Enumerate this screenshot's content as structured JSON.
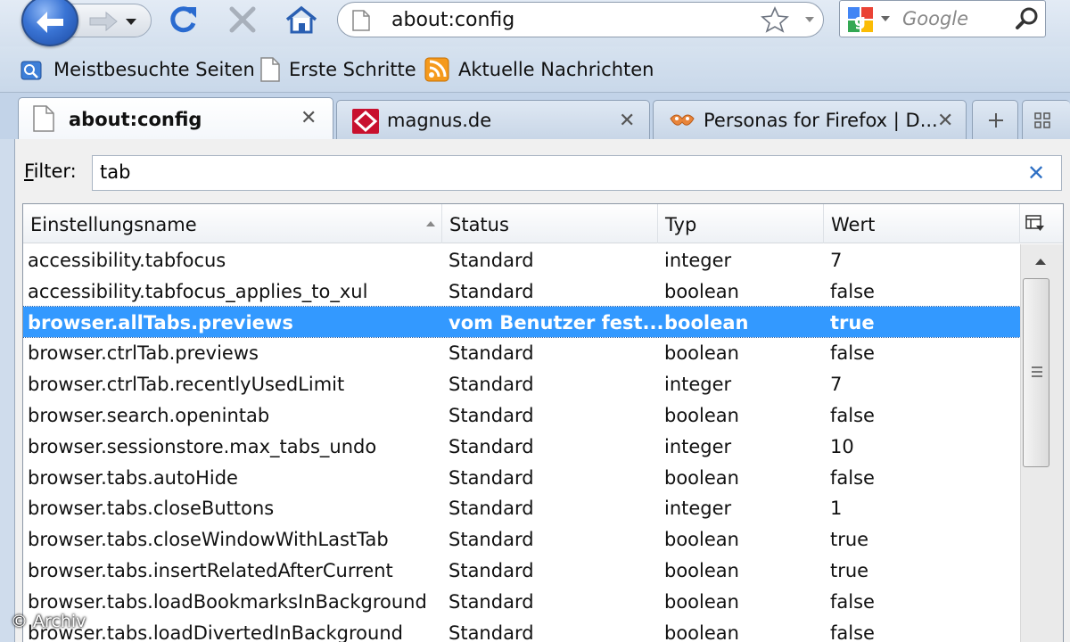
{
  "toolbar": {
    "url": "about:config",
    "search_placeholder": "Google"
  },
  "bookmarks": [
    {
      "label": "Meistbesuchte Seiten",
      "icon": "most-visited-icon"
    },
    {
      "label": "Erste Schritte",
      "icon": "page-icon"
    },
    {
      "label": "Aktuelle Nachrichten",
      "icon": "rss-feed-icon"
    }
  ],
  "tabs": [
    {
      "title": "about:config",
      "active": true
    },
    {
      "title": "magnus.de",
      "active": false
    },
    {
      "title": "Personas for Firefox | D...",
      "active": false
    }
  ],
  "filter": {
    "label_underlined": "F",
    "label_rest": "ilter:",
    "value": "tab"
  },
  "columns": {
    "name": "Einstellungsname",
    "status": "Status",
    "type": "Typ",
    "value": "Wert"
  },
  "rows": [
    {
      "name": "accessibility.tabfocus",
      "status": "Standard",
      "type": "integer",
      "value": "7"
    },
    {
      "name": "accessibility.tabfocus_applies_to_xul",
      "status": "Standard",
      "type": "boolean",
      "value": "false"
    },
    {
      "name": "browser.allTabs.previews",
      "status": "vom Benutzer fest...",
      "type": "boolean",
      "value": "true"
    },
    {
      "name": "browser.ctrlTab.previews",
      "status": "Standard",
      "type": "boolean",
      "value": "false"
    },
    {
      "name": "browser.ctrlTab.recentlyUsedLimit",
      "status": "Standard",
      "type": "integer",
      "value": "7"
    },
    {
      "name": "browser.search.openintab",
      "status": "Standard",
      "type": "boolean",
      "value": "false"
    },
    {
      "name": "browser.sessionstore.max_tabs_undo",
      "status": "Standard",
      "type": "integer",
      "value": "10"
    },
    {
      "name": "browser.tabs.autoHide",
      "status": "Standard",
      "type": "boolean",
      "value": "false"
    },
    {
      "name": "browser.tabs.closeButtons",
      "status": "Standard",
      "type": "integer",
      "value": "1"
    },
    {
      "name": "browser.tabs.closeWindowWithLastTab",
      "status": "Standard",
      "type": "boolean",
      "value": "true"
    },
    {
      "name": "browser.tabs.insertRelatedAfterCurrent",
      "status": "Standard",
      "type": "boolean",
      "value": "true"
    },
    {
      "name": "browser.tabs.loadBookmarksInBackground",
      "status": "Standard",
      "type": "boolean",
      "value": "false"
    },
    {
      "name": "browser.tabs.loadDivertedInBackground",
      "status": "Standard",
      "type": "boolean",
      "value": "false"
    }
  ],
  "selected_row": 2,
  "watermark": "© Archiv",
  "colors": {
    "selection": "#3399ff",
    "chrome": "#cfdcec",
    "accent": "#2d6fc4"
  }
}
